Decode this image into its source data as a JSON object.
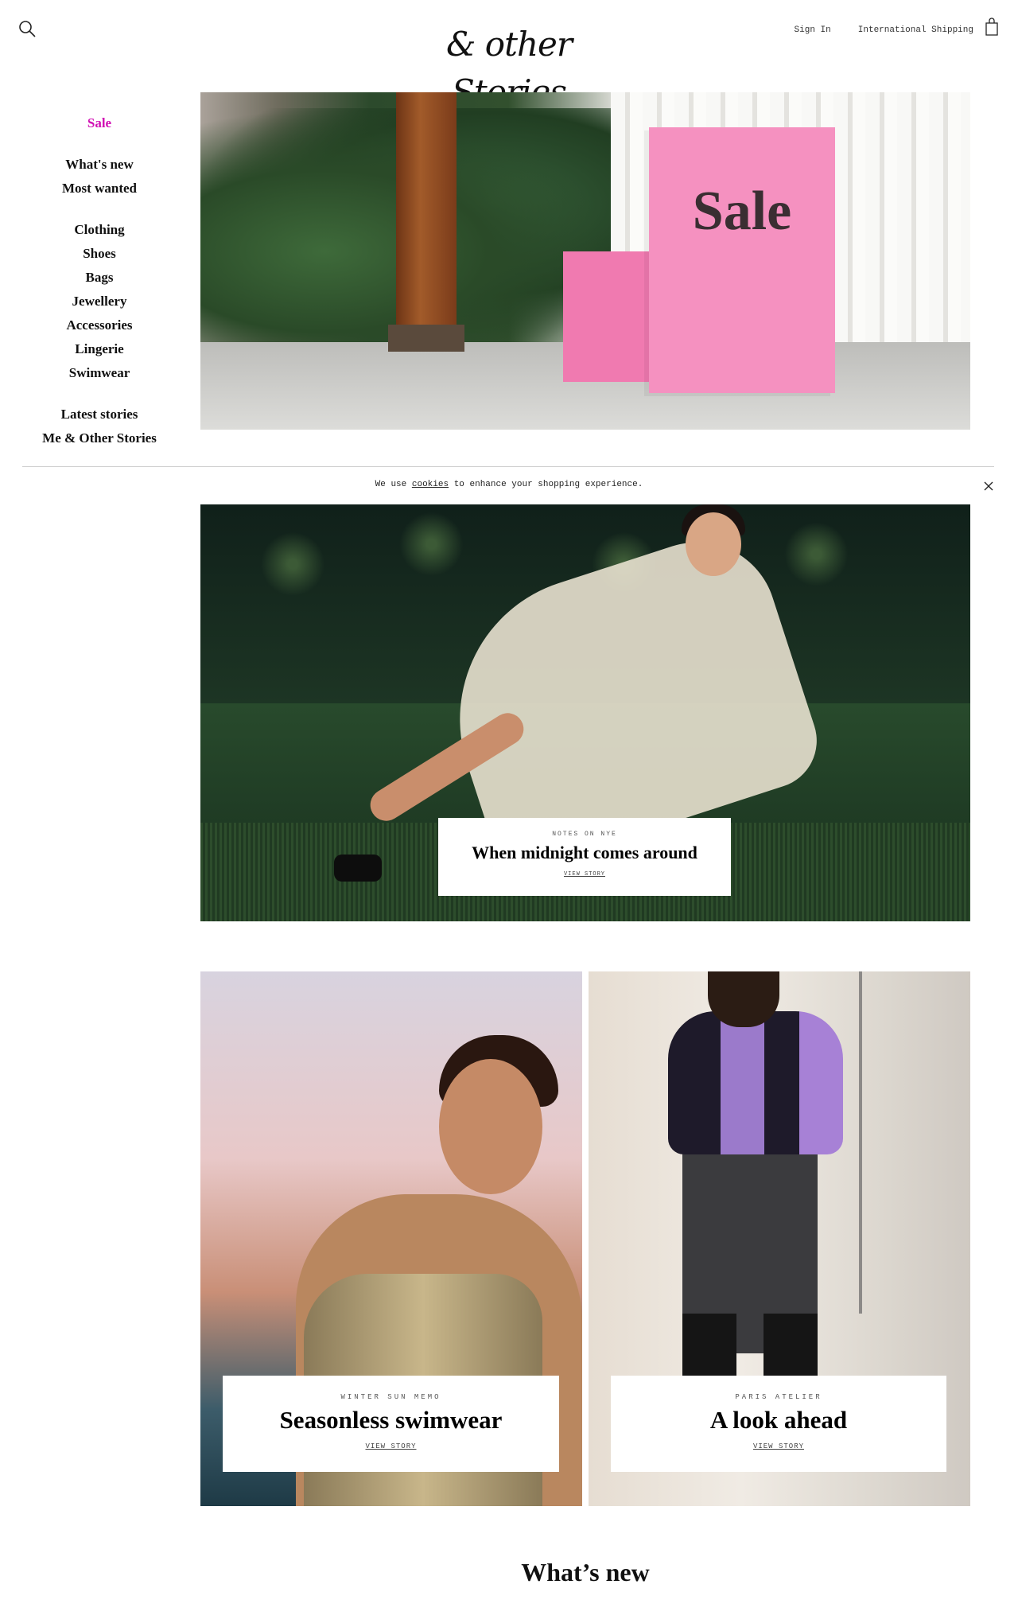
{
  "header": {
    "logo": "& other Stories",
    "sign_in": "Sign In",
    "shipping": "International Shipping"
  },
  "sidebar": {
    "sale": "Sale",
    "group1": [
      "What's new",
      "Most wanted"
    ],
    "group2": [
      "Clothing",
      "Shoes",
      "Bags",
      "Jewellery",
      "Accessories",
      "Lingerie",
      "Swimwear"
    ],
    "group3": [
      "Latest stories",
      "Me & Other Stories"
    ]
  },
  "hero": {
    "sign_text": "Sale"
  },
  "cookie": {
    "prefix": "We use ",
    "link": "cookies",
    "suffix": " to enhance your shopping experience."
  },
  "stories": [
    {
      "eyebrow": "NOTES ON NYE",
      "title": "When midnight comes around",
      "cta": "VIEW STORY"
    },
    {
      "eyebrow": "WINTER SUN MEMO",
      "title": "Seasonless swimwear",
      "cta": "VIEW STORY"
    },
    {
      "eyebrow": "PARIS ATELIER",
      "title": "A look ahead",
      "cta": "VIEW STORY"
    }
  ],
  "section": {
    "whats_new": "What’s new"
  },
  "colors": {
    "sale_accent": "#d110b4",
    "sale_pink": "#f591c0"
  },
  "icons": [
    "search-icon",
    "shopping-bag-icon",
    "close-icon"
  ]
}
